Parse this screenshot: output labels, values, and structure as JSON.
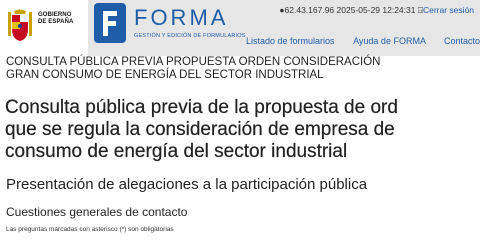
{
  "header": {
    "gov_logo_text_line1": "GOBIERNO",
    "gov_logo_text_line2": "DE ESPAÑA",
    "brand_name": "FORMA",
    "brand_tagline": "GESTIÓN Y EDICIÓN DE FORMULARIOS",
    "session_ip": "62.43.167.96",
    "session_datetime": "2025-05-29 12:24:31",
    "logout_label": "Cerrar sesión",
    "nav": [
      "Listado de formularios",
      "Ayuda de FORMA",
      "Contacto"
    ]
  },
  "content": {
    "breadcrumb_line1": "CONSULTA PÚBLICA PREVIA PROPUESTA ORDEN CONSIDERACIÓN",
    "breadcrumb_line2": "GRAN CONSUMO DE ENERGÍA DEL SECTOR INDUSTRIAL",
    "title_line1": "Consulta pública previa de la propuesta de ord",
    "title_line2": "que se regula la consideración de empresa de",
    "title_line3": "consumo de energía del sector industrial",
    "section_heading": "Presentación de alegaciones a la participación pública",
    "subsection_heading": "Cuestiones generales de contacto",
    "mandatory_note": "Las preguntas marcadas con asterisco (*) son obligatorias"
  },
  "colors": {
    "header_bg": "#e6e6e6",
    "brand_blue": "#1f5da8",
    "text": "#222222"
  }
}
